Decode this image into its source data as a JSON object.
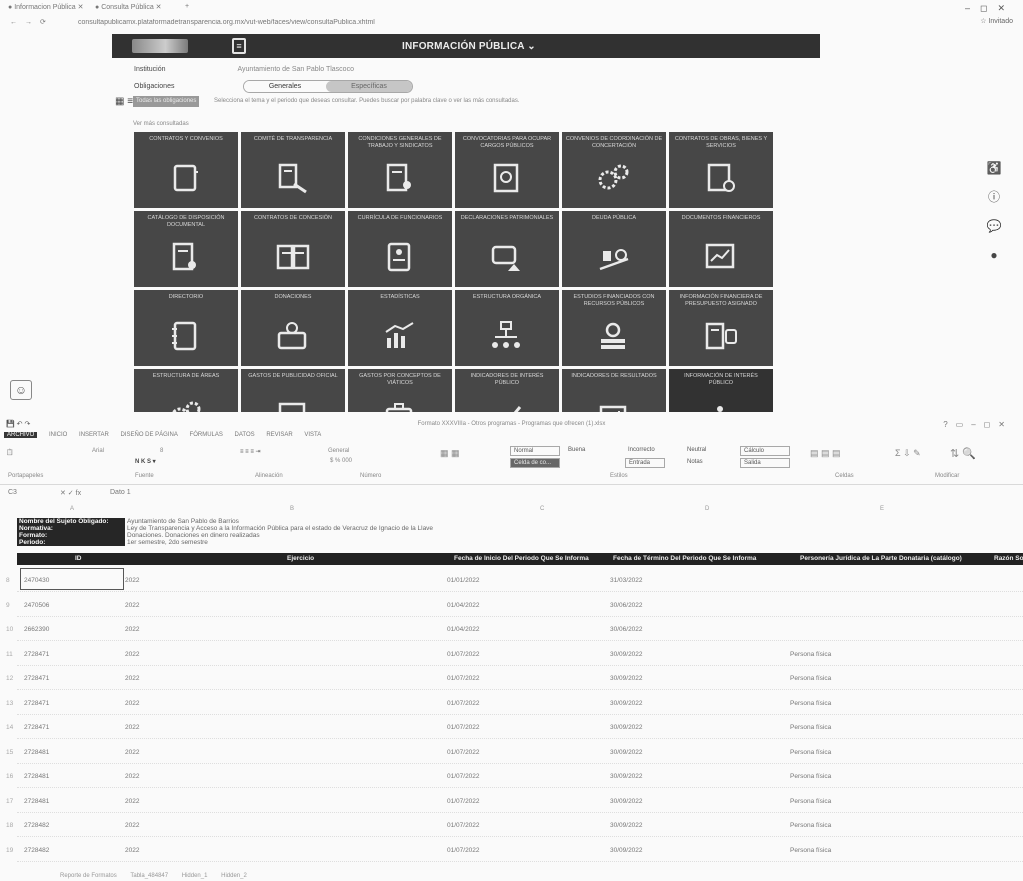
{
  "browser": {
    "tab_title": "Informacion Pública",
    "tab2_title": "Consulta Pública",
    "url": "consultapublicamx.plataformadetransparencia.org.mx/vut-web/faces/view/consultaPublica.xhtml",
    "profile": "Invitado"
  },
  "site": {
    "header_title": "INFORMACIÓN PÚBLICA",
    "institucion_label": "Institución",
    "institucion_value": "Ayuntamiento de San Pablo Tlascoco",
    "obligaciones_label": "Obligaciones",
    "tabs": [
      "Generales",
      "Específicas"
    ],
    "search_tag": "Todas las obligaciones",
    "description": "Selecciona el tema y el periodo que deseas consultar. Puedes buscar por palabra clave o ver las más consultadas.",
    "sub_link": "Ver más consultadas",
    "tiles": [
      {
        "label": "Contratos y convenios",
        "icon": "notebook-icon"
      },
      {
        "label": "Comité de transparencia",
        "icon": "document-gavel-icon"
      },
      {
        "label": "Condiciones generales de trabajo y sindicatos",
        "icon": "document-people-icon"
      },
      {
        "label": "Convocatorias para ocupar cargos públicos",
        "icon": "document-search-icon"
      },
      {
        "label": "Convenios de coordinación de concertación",
        "icon": "gears-icon"
      },
      {
        "label": "Contratos de obras, bienes y servicios",
        "icon": "document-gear-icon"
      },
      {
        "label": "Catálogo de disposición documental",
        "icon": "document-person-icon"
      },
      {
        "label": "Contratos de concesión",
        "icon": "contracts-icon"
      },
      {
        "label": "Currícula de funcionarios",
        "icon": "profile-card-icon"
      },
      {
        "label": "Declaraciones patrimoniales",
        "icon": "document-house-icon"
      },
      {
        "label": "Deuda pública",
        "icon": "scale-money-icon"
      },
      {
        "label": "Documentos financieros",
        "icon": "chart-screen-icon"
      },
      {
        "label": "Directorio",
        "icon": "address-book-icon"
      },
      {
        "label": "Donaciones",
        "icon": "donation-box-icon"
      },
      {
        "label": "Estadísticas",
        "icon": "bar-chart-icon"
      },
      {
        "label": "Estructura orgánica",
        "icon": "org-chart-icon"
      },
      {
        "label": "Estudios financiados con recursos públicos",
        "icon": "money-stack-icon"
      },
      {
        "label": "Información financiera de presupuesto asignado",
        "icon": "list-money-icon"
      },
      {
        "label": "Estructura de áreas",
        "icon": "gears-icon"
      },
      {
        "label": "Gastos de publicidad oficial",
        "icon": "monitor-icon"
      },
      {
        "label": "Gastos por conceptos de viáticos",
        "icon": "briefcase-icon"
      },
      {
        "label": "Indicadores de interés público",
        "icon": "trend-icon"
      },
      {
        "label": "Indicadores de resultados",
        "icon": "chart-icon"
      },
      {
        "label": "Información de interés público",
        "icon": "info-icon"
      }
    ]
  },
  "excel": {
    "title": "Formato XXXVIIIa - Otros programas - Programas que ofrecen (1).xlsx",
    "menu": [
      "ARCHIVO",
      "INICIO",
      "INSERTAR",
      "DISEÑO DE PÁGINA",
      "FÓRMULAS",
      "DATOS",
      "REVISAR",
      "VISTA"
    ],
    "ribbon": {
      "font": "Arial",
      "size": "8",
      "format": "General",
      "styles": [
        "Normal",
        "Buena",
        "Incorrecto",
        "Neutral",
        "Cálculo",
        "Celda de co...",
        "Entrada",
        "Notas",
        "Salida"
      ],
      "groups": [
        "Portapapeles",
        "Fuente",
        "Alineación",
        "Número",
        "Estilos",
        "Celdas",
        "Modificar"
      ]
    },
    "cell_ref": "C3",
    "formula_value": "Dato 1",
    "meta": [
      {
        "label": "Nombre del Sujeto Obligado:",
        "value": "Ayuntamiento de San Pablo de Barrios"
      },
      {
        "label": "Normativa:",
        "value": "Ley de Transparencia y Acceso a la Información Pública para el estado de Veracruz de Ignacio de la Llave"
      },
      {
        "label": "Formato:",
        "value": "Donaciones. Donaciones en dinero realizadas"
      },
      {
        "label": "Periodo:",
        "value": "1er semestre, 2do semestre"
      }
    ],
    "columns": [
      "ID",
      "Ejercicio",
      "Fecha de Inicio Del Periodo Que Se Informa",
      "Fecha de Término Del Periodo Que Se Informa",
      "Personería Jurídica de La Parte Donataria (catálogo)",
      "Razón Soc"
    ],
    "rows": [
      {
        "id": "2470430",
        "ejercicio": "2022",
        "inicio": "01/01/2022",
        "termino": "31/03/2022",
        "personeria": ""
      },
      {
        "id": "2470506",
        "ejercicio": "2022",
        "inicio": "01/04/2022",
        "termino": "30/06/2022",
        "personeria": ""
      },
      {
        "id": "2662390",
        "ejercicio": "2022",
        "inicio": "01/04/2022",
        "termino": "30/06/2022",
        "personeria": ""
      },
      {
        "id": "2728471",
        "ejercicio": "2022",
        "inicio": "01/07/2022",
        "termino": "30/09/2022",
        "personeria": "Persona física"
      },
      {
        "id": "2728471",
        "ejercicio": "2022",
        "inicio": "01/07/2022",
        "termino": "30/09/2022",
        "personeria": "Persona física"
      },
      {
        "id": "2728471",
        "ejercicio": "2022",
        "inicio": "01/07/2022",
        "termino": "30/09/2022",
        "personeria": "Persona física"
      },
      {
        "id": "2728471",
        "ejercicio": "2022",
        "inicio": "01/07/2022",
        "termino": "30/09/2022",
        "personeria": "Persona física"
      },
      {
        "id": "2728481",
        "ejercicio": "2022",
        "inicio": "01/07/2022",
        "termino": "30/09/2022",
        "personeria": "Persona física"
      },
      {
        "id": "2728481",
        "ejercicio": "2022",
        "inicio": "01/07/2022",
        "termino": "30/09/2022",
        "personeria": "Persona física"
      },
      {
        "id": "2728481",
        "ejercicio": "2022",
        "inicio": "01/07/2022",
        "termino": "30/09/2022",
        "personeria": "Persona física"
      },
      {
        "id": "2728482",
        "ejercicio": "2022",
        "inicio": "01/07/2022",
        "termino": "30/09/2022",
        "personeria": "Persona física"
      },
      {
        "id": "2728482",
        "ejercicio": "2022",
        "inicio": "01/07/2022",
        "termino": "30/09/2022",
        "personeria": "Persona física"
      }
    ],
    "row_numbers": [
      "8",
      "9",
      "10",
      "11",
      "12",
      "13",
      "14",
      "15",
      "16",
      "17",
      "18",
      "19"
    ],
    "sheet_tabs": [
      "Reporte de Formatos",
      "Tabla_484847",
      "Hidden_1",
      "Hidden_2"
    ]
  }
}
